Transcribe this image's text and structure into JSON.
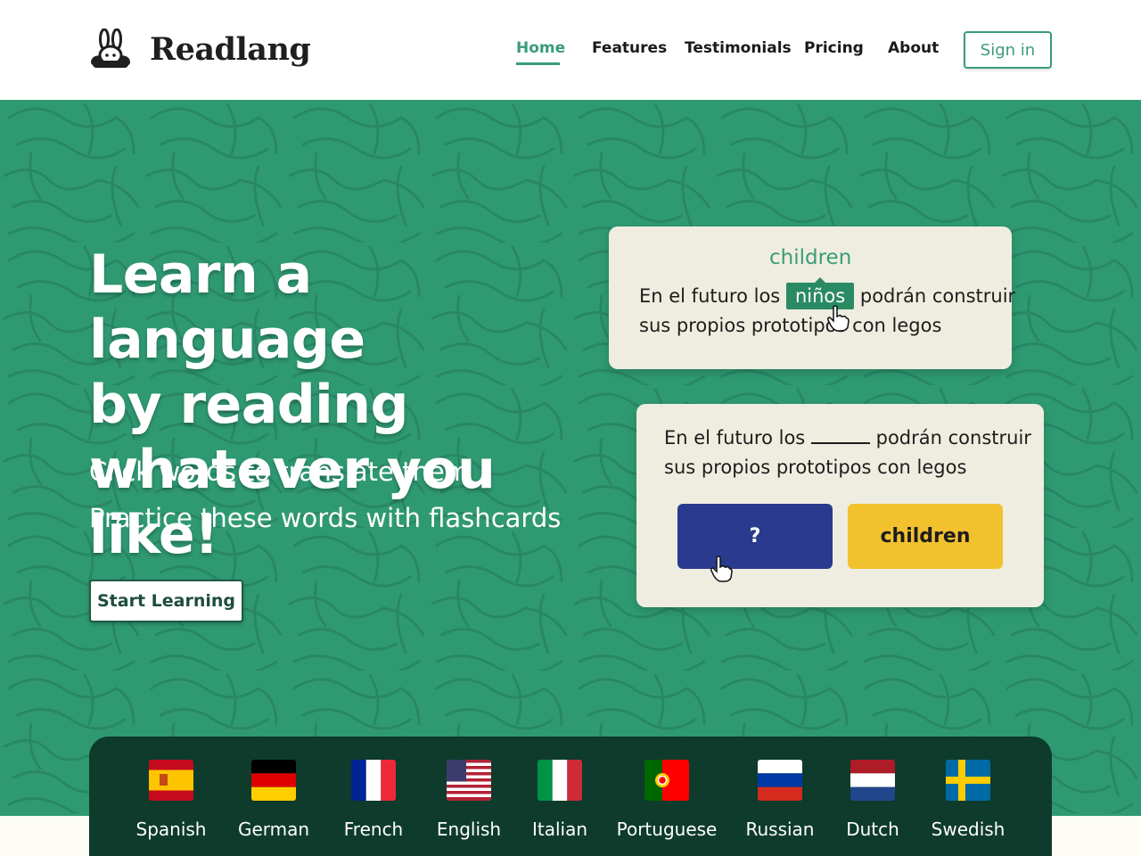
{
  "header": {
    "brand": "Readlang",
    "nav": [
      {
        "label": "Home",
        "active": true
      },
      {
        "label": "Features",
        "active": false
      },
      {
        "label": "Testimonials",
        "active": false
      },
      {
        "label": "Pricing",
        "active": false
      },
      {
        "label": "About",
        "active": false
      }
    ],
    "signin_label": "Sign in"
  },
  "hero": {
    "title_lines": [
      "Learn a language",
      "by reading",
      "whatever you like!"
    ],
    "lines": [
      "Click words to translate them",
      "Practice these words with flashcards"
    ],
    "cta_label": "Start Learning",
    "reader_demo": {
      "translation": "children",
      "before": "En el futuro los",
      "highlight": "niños",
      "after": "podrán construir",
      "line2": "sus propios prototipos con legos"
    },
    "flashcard_demo": {
      "before": "En el futuro los",
      "after": "podrán construir",
      "line2": "sus propios prototipos con legos",
      "question_label": "?",
      "answer_label": "children"
    }
  },
  "languages": [
    {
      "name": "Spanish",
      "flag": "spain-flag-icon"
    },
    {
      "name": "German",
      "flag": "germany-flag-icon"
    },
    {
      "name": "French",
      "flag": "france-flag-icon"
    },
    {
      "name": "English",
      "flag": "usa-flag-icon"
    },
    {
      "name": "Italian",
      "flag": "italy-flag-icon"
    },
    {
      "name": "Portuguese",
      "flag": "portugal-flag-icon"
    },
    {
      "name": "Russian",
      "flag": "russia-flag-icon"
    },
    {
      "name": "Dutch",
      "flag": "netherlands-flag-icon"
    },
    {
      "name": "Swedish",
      "flag": "sweden-flag-icon"
    }
  ],
  "colors": {
    "brand_green": "#2f9a72",
    "accent_green": "#3a9c78",
    "dark_green": "#0e3b2c",
    "card_bg": "#efede0",
    "flashcard_blue": "#2a3a8f",
    "flashcard_yellow": "#f2c12e"
  }
}
